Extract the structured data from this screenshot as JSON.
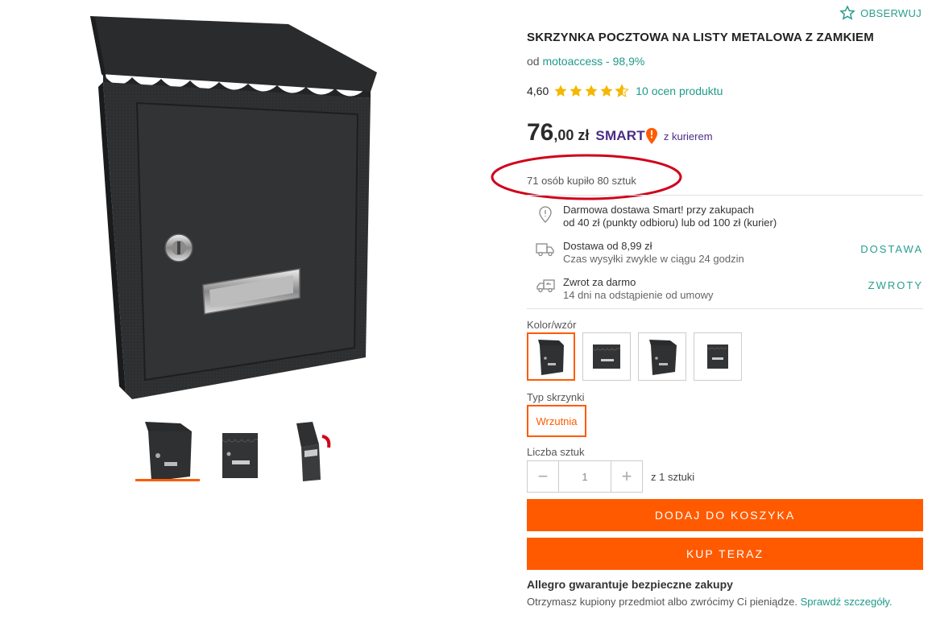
{
  "product": {
    "title": "SKRZYNKA POCZTOWA NA LISTY METALOWA Z ZAMKIEM",
    "observe_label": "OBSERWUJ",
    "seller_prefix": "od",
    "seller_name": "motoaccess - 98,9%",
    "rating_value": "4,60",
    "rating_stars": 4.6,
    "rating_link": "10 ocen produktu",
    "price_integer": "76",
    "price_rest": ",00 zł",
    "smart_label": "SMART",
    "smart_courier": "z kurierem",
    "sold_text": "71 osób kupiło 80 sztuk"
  },
  "delivery": {
    "free": {
      "line1": "Darmowa dostawa Smart! przy zakupach",
      "line2": "od 40 zł (punkty odbioru) lub od 100 zł (kurier)"
    },
    "shipping": {
      "line1": "Dostawa od 8,99 zł",
      "line2": "Czas wysyłki zwykle w ciągu 24 godzin",
      "link": "DOSTAWA"
    },
    "returns": {
      "line1": "Zwrot za darmo",
      "line2": "14 dni na odstąpienie od umowy",
      "link": "ZWROTY"
    }
  },
  "options": {
    "color_label": "Kolor/wzór",
    "type_label": "Typ skrzynki",
    "type_value": "Wrzutnia",
    "quantity_label": "Liczba sztuk",
    "quantity_value": "1",
    "quantity_minus": "−",
    "quantity_plus": "+",
    "quantity_of": "z 1 sztuki"
  },
  "actions": {
    "add_to_cart": "DODAJ DO KOSZYKA",
    "buy_now": "KUP TERAZ"
  },
  "guarantee": {
    "title": "Allegro gwarantuje bezpieczne zakupy",
    "text": "Otrzymasz kupiony przedmiot albo zwrócimy Ci pieniądze.",
    "link": "Sprawdź szczegóły."
  },
  "colors": {
    "accent": "#ff5a00",
    "link": "#1e9a8a",
    "smart": "#4b2c86",
    "annotation": "#d0021b"
  }
}
